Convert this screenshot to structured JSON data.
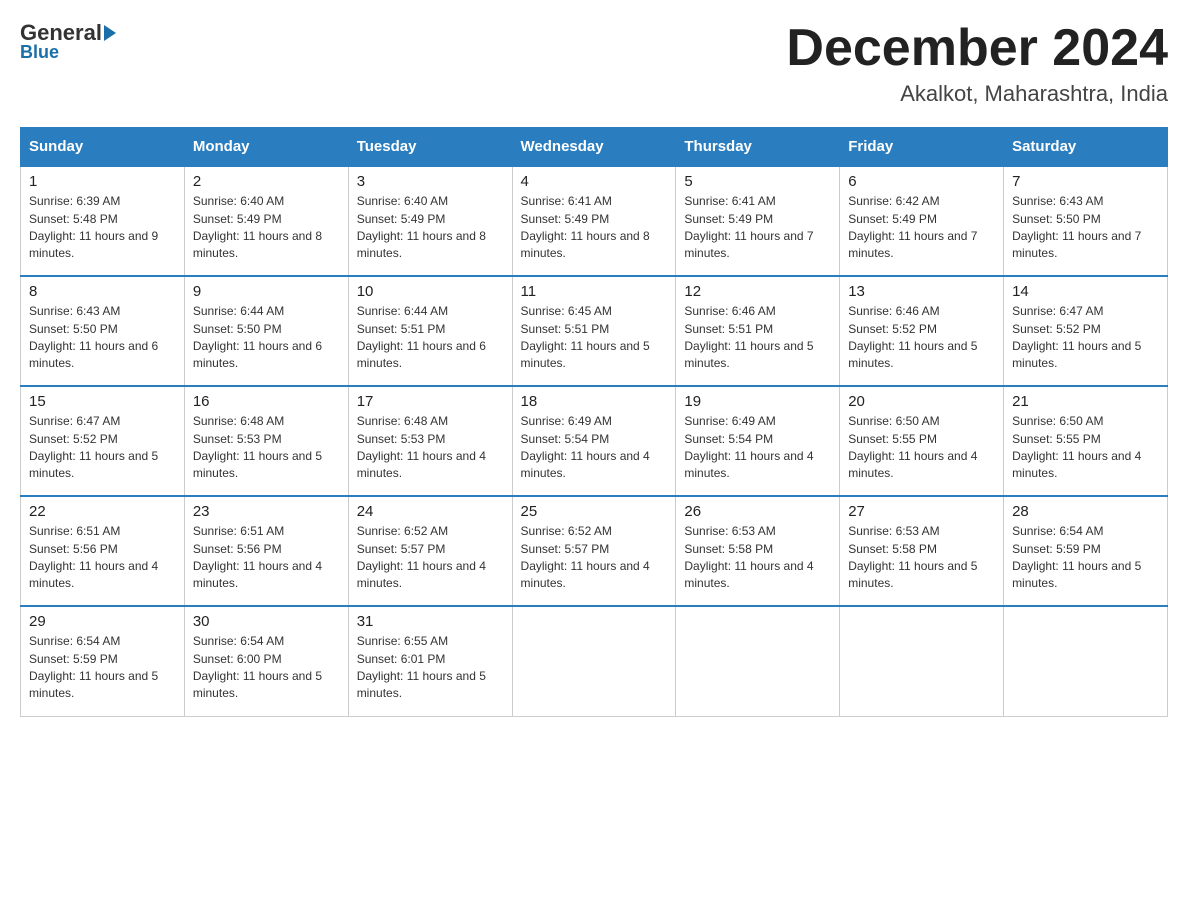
{
  "header": {
    "logo": {
      "general": "General",
      "blue": "Blue"
    },
    "title": "December 2024",
    "location": "Akalkot, Maharashtra, India"
  },
  "days_of_week": [
    "Sunday",
    "Monday",
    "Tuesday",
    "Wednesday",
    "Thursday",
    "Friday",
    "Saturday"
  ],
  "weeks": [
    [
      {
        "day": "1",
        "sunrise": "6:39 AM",
        "sunset": "5:48 PM",
        "daylight": "11 hours and 9 minutes."
      },
      {
        "day": "2",
        "sunrise": "6:40 AM",
        "sunset": "5:49 PM",
        "daylight": "11 hours and 8 minutes."
      },
      {
        "day": "3",
        "sunrise": "6:40 AM",
        "sunset": "5:49 PM",
        "daylight": "11 hours and 8 minutes."
      },
      {
        "day": "4",
        "sunrise": "6:41 AM",
        "sunset": "5:49 PM",
        "daylight": "11 hours and 8 minutes."
      },
      {
        "day": "5",
        "sunrise": "6:41 AM",
        "sunset": "5:49 PM",
        "daylight": "11 hours and 7 minutes."
      },
      {
        "day": "6",
        "sunrise": "6:42 AM",
        "sunset": "5:49 PM",
        "daylight": "11 hours and 7 minutes."
      },
      {
        "day": "7",
        "sunrise": "6:43 AM",
        "sunset": "5:50 PM",
        "daylight": "11 hours and 7 minutes."
      }
    ],
    [
      {
        "day": "8",
        "sunrise": "6:43 AM",
        "sunset": "5:50 PM",
        "daylight": "11 hours and 6 minutes."
      },
      {
        "day": "9",
        "sunrise": "6:44 AM",
        "sunset": "5:50 PM",
        "daylight": "11 hours and 6 minutes."
      },
      {
        "day": "10",
        "sunrise": "6:44 AM",
        "sunset": "5:51 PM",
        "daylight": "11 hours and 6 minutes."
      },
      {
        "day": "11",
        "sunrise": "6:45 AM",
        "sunset": "5:51 PM",
        "daylight": "11 hours and 5 minutes."
      },
      {
        "day": "12",
        "sunrise": "6:46 AM",
        "sunset": "5:51 PM",
        "daylight": "11 hours and 5 minutes."
      },
      {
        "day": "13",
        "sunrise": "6:46 AM",
        "sunset": "5:52 PM",
        "daylight": "11 hours and 5 minutes."
      },
      {
        "day": "14",
        "sunrise": "6:47 AM",
        "sunset": "5:52 PM",
        "daylight": "11 hours and 5 minutes."
      }
    ],
    [
      {
        "day": "15",
        "sunrise": "6:47 AM",
        "sunset": "5:52 PM",
        "daylight": "11 hours and 5 minutes."
      },
      {
        "day": "16",
        "sunrise": "6:48 AM",
        "sunset": "5:53 PM",
        "daylight": "11 hours and 5 minutes."
      },
      {
        "day": "17",
        "sunrise": "6:48 AM",
        "sunset": "5:53 PM",
        "daylight": "11 hours and 4 minutes."
      },
      {
        "day": "18",
        "sunrise": "6:49 AM",
        "sunset": "5:54 PM",
        "daylight": "11 hours and 4 minutes."
      },
      {
        "day": "19",
        "sunrise": "6:49 AM",
        "sunset": "5:54 PM",
        "daylight": "11 hours and 4 minutes."
      },
      {
        "day": "20",
        "sunrise": "6:50 AM",
        "sunset": "5:55 PM",
        "daylight": "11 hours and 4 minutes."
      },
      {
        "day": "21",
        "sunrise": "6:50 AM",
        "sunset": "5:55 PM",
        "daylight": "11 hours and 4 minutes."
      }
    ],
    [
      {
        "day": "22",
        "sunrise": "6:51 AM",
        "sunset": "5:56 PM",
        "daylight": "11 hours and 4 minutes."
      },
      {
        "day": "23",
        "sunrise": "6:51 AM",
        "sunset": "5:56 PM",
        "daylight": "11 hours and 4 minutes."
      },
      {
        "day": "24",
        "sunrise": "6:52 AM",
        "sunset": "5:57 PM",
        "daylight": "11 hours and 4 minutes."
      },
      {
        "day": "25",
        "sunrise": "6:52 AM",
        "sunset": "5:57 PM",
        "daylight": "11 hours and 4 minutes."
      },
      {
        "day": "26",
        "sunrise": "6:53 AM",
        "sunset": "5:58 PM",
        "daylight": "11 hours and 4 minutes."
      },
      {
        "day": "27",
        "sunrise": "6:53 AM",
        "sunset": "5:58 PM",
        "daylight": "11 hours and 5 minutes."
      },
      {
        "day": "28",
        "sunrise": "6:54 AM",
        "sunset": "5:59 PM",
        "daylight": "11 hours and 5 minutes."
      }
    ],
    [
      {
        "day": "29",
        "sunrise": "6:54 AM",
        "sunset": "5:59 PM",
        "daylight": "11 hours and 5 minutes."
      },
      {
        "day": "30",
        "sunrise": "6:54 AM",
        "sunset": "6:00 PM",
        "daylight": "11 hours and 5 minutes."
      },
      {
        "day": "31",
        "sunrise": "6:55 AM",
        "sunset": "6:01 PM",
        "daylight": "11 hours and 5 minutes."
      },
      null,
      null,
      null,
      null
    ]
  ]
}
